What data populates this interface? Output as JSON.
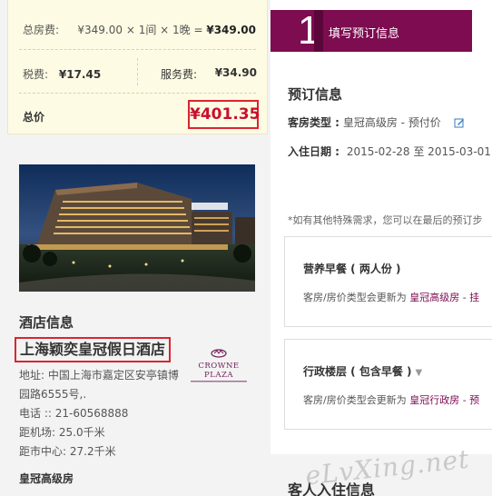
{
  "price": {
    "total_room_label": "总房费:",
    "total_room_formula_prefix": "¥349.00 × 1间 × 1晚 = ",
    "total_room_value": "¥349.00",
    "tax_label": "税费:",
    "tax_value": "¥17.45",
    "service_label": "服务费:",
    "service_value": "¥34.90",
    "grand_label": "总价",
    "grand_value": "¥401.35"
  },
  "hotel": {
    "info_title": "酒店信息",
    "name": "上海颖奕皇冠假日酒店",
    "logo_brand": "CROWNE PLAZA",
    "address_line1": "地址: 中国上海市嘉定区安亭镇博",
    "address_line2": "园路6555号,.",
    "tel": "电话 :: 21-60568888",
    "airport": "距机场: 25.0千米",
    "center": "距市中心: 27.2千米",
    "room_type": "皇冠高级房"
  },
  "step": {
    "number": "1",
    "label": "填写预订信息"
  },
  "booking": {
    "title": "预订信息",
    "room_type_key": "客房类型 :",
    "room_type_value": "皇冠高级房 - 预付价",
    "date_key": "入住日期 :",
    "date_value": "2015-02-28 至 2015-03-01",
    "note": "*如有其他特殊需求，您可以在最后的预订步"
  },
  "cards": [
    {
      "title": "营养早餐 ( 两人份 )",
      "note_prefix": "客房/房价类型会更新为 ",
      "note_highlight": "皇冠高级房 - 挂"
    },
    {
      "title": "行政楼层 ( 包含早餐 )",
      "note_prefix": "客房/房价类型会更新为 ",
      "note_highlight": "皇冠行政房 - 预"
    }
  ],
  "guest_title": "客人入住信息",
  "watermark": "eLvXing.net",
  "colors": {
    "accent": "#7d0c50",
    "highlight_border": "#d9262f",
    "price_red": "#c8102e"
  }
}
